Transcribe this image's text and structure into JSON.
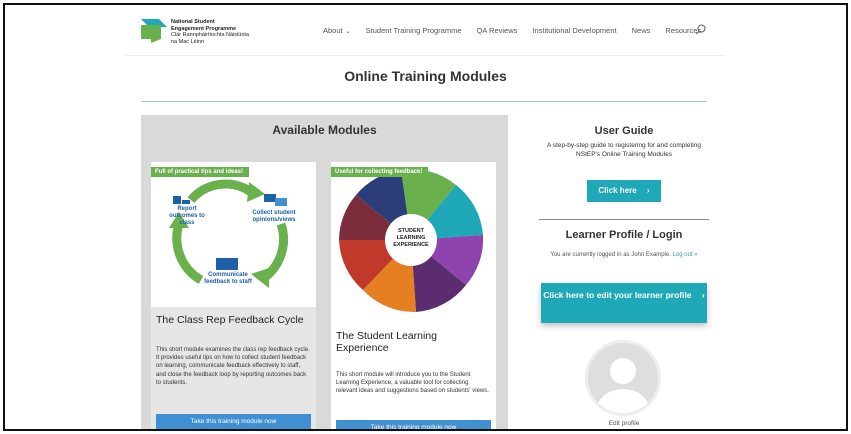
{
  "brand": {
    "line1": "National Student",
    "line2": "Engagement Programme",
    "line3": "Clár Rannpháirtíochta Náisiúnta",
    "line4": "na Mac Léinn",
    "colors": {
      "green": "#6ab04c",
      "teal": "#1fa8b8"
    }
  },
  "nav": {
    "items": [
      {
        "label": "About",
        "has_chevron": true
      },
      {
        "label": "Student Training Programme"
      },
      {
        "label": "QA Reviews"
      },
      {
        "label": "Institutional Development"
      },
      {
        "label": "News"
      },
      {
        "label": "Resources"
      }
    ],
    "chevron": "⌄",
    "search_icon": "search-icon"
  },
  "page": {
    "title": "Online Training Modules"
  },
  "modules": {
    "heading": "Available Modules",
    "cards": [
      {
        "tag": "Full of practical tips and ideas!",
        "title": "The Class Rep Feedback Cycle",
        "diagram_labels": [
          "Report outcomes to class",
          "Collect student opinions/views",
          "Communicate feedback to staff"
        ],
        "description": "This short module examines the class rep feedback cycle. It provides useful tips on how to collect student feedback on learning, communicate feedback effectively to staff, and close the feedback loop by reporting outcomes back to students.",
        "button": "Take this training module now"
      },
      {
        "tag": "Useful for collecting feedback!",
        "title": "The Student Learning Experience",
        "center_label": "STUDENT LEARNING EXPERIENCE",
        "description": "This short module will introduce you to the Student Learning Experience, a valuable tool for collecting relevant ideas and suggestions based on students' views.",
        "button": "Take this training module now"
      }
    ]
  },
  "sidebar": {
    "guide_title": "User Guide",
    "guide_text": "A step-by-step guide to registering for and completing NStEP's Online Training Modules",
    "guide_button": "Click here",
    "profile_title": "Learner Profile / Login",
    "logged_in_text": "You are currently logged in as John Example.",
    "logout_link": "Log out »",
    "edit_button": "Click here to edit your learner profile",
    "edit_profile_label": "Edit profile",
    "arrow": "›"
  }
}
